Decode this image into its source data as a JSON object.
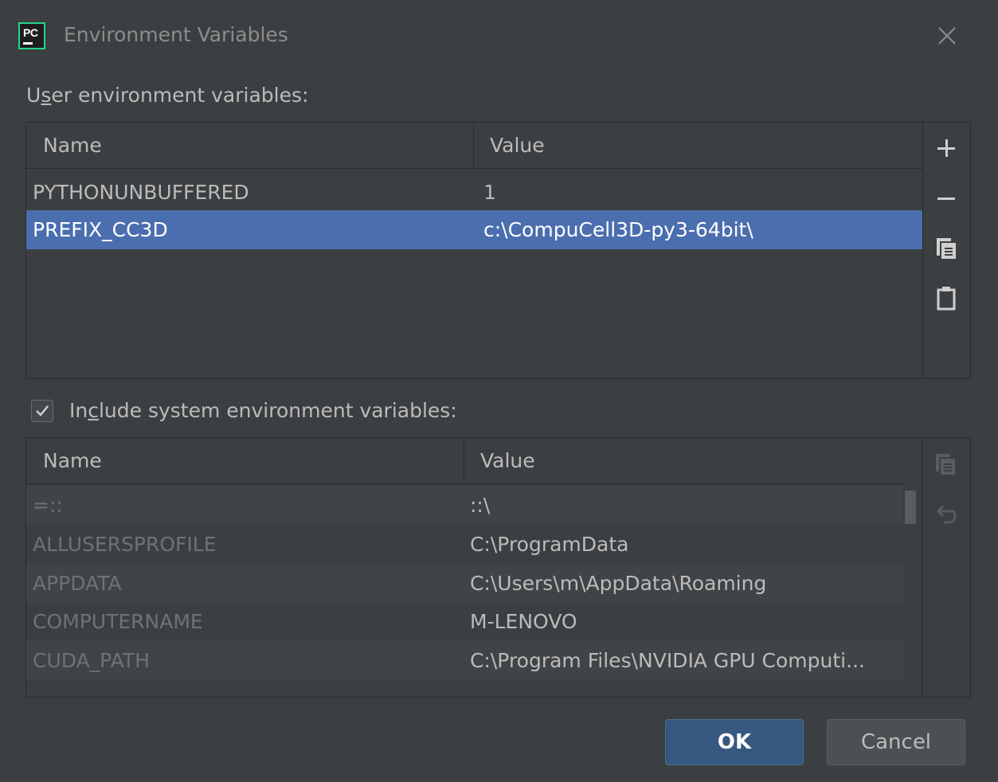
{
  "dialog": {
    "title": "Environment Variables",
    "app_icon": "pycharm-icon",
    "app_icon_text": "PC",
    "close_icon": "close-icon"
  },
  "user_section": {
    "label_prefix": "U",
    "label_underlined": "s",
    "label_rest": "er environment variables:",
    "columns": [
      "Name",
      "Value"
    ],
    "rows": [
      {
        "name": "PYTHONUNBUFFERED",
        "value": "1",
        "selected": false
      },
      {
        "name": "PREFIX_CC3D",
        "value": "c:\\CompuCell3D-py3-64bit\\",
        "selected": true
      }
    ],
    "toolbar": [
      "add-icon",
      "remove-icon",
      "copy-icon",
      "paste-icon"
    ]
  },
  "system_section": {
    "checkbox_checked": true,
    "label_prefix": "In",
    "label_underlined": "c",
    "label_rest": "lude system environment variables:",
    "columns": [
      "Name",
      "Value"
    ],
    "rows": [
      {
        "name": "=::",
        "value": "::\\"
      },
      {
        "name": "ALLUSERSPROFILE",
        "value": "C:\\ProgramData"
      },
      {
        "name": "APPDATA",
        "value": "C:\\Users\\m\\AppData\\Roaming"
      },
      {
        "name": "COMPUTERNAME",
        "value": "M-LENOVO"
      },
      {
        "name": "CUDA_PATH",
        "value": "C:\\Program Files\\NVIDIA GPU Computi..."
      }
    ],
    "toolbar": [
      "copy-icon",
      "revert-icon"
    ]
  },
  "buttons": {
    "ok": "OK",
    "cancel": "Cancel"
  },
  "colors": {
    "background": "#3c3f41",
    "selection": "#4b6eaf",
    "ok_button": "#365880"
  }
}
